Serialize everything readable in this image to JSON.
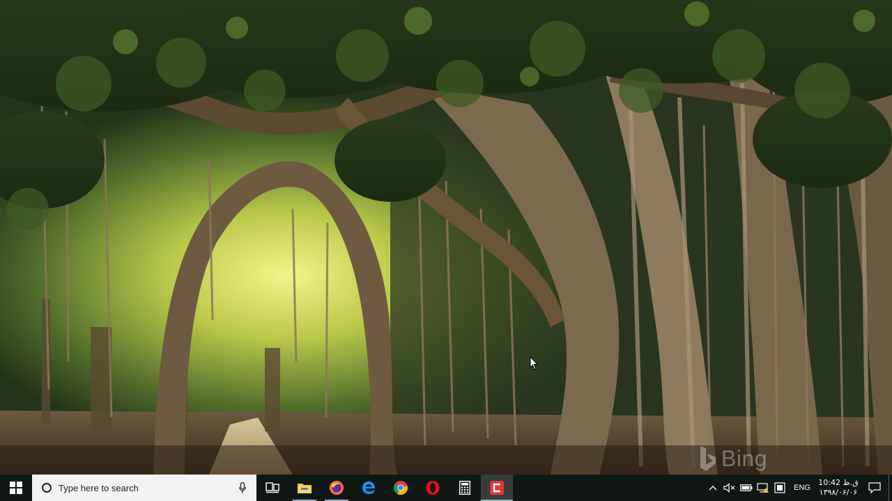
{
  "wallpaper": {
    "name": "banyan-forest",
    "provider": "Bing"
  },
  "watermark": {
    "text": "Bing"
  },
  "taskbar": {
    "search": {
      "placeholder": "Type here to search"
    },
    "pinned": [
      {
        "name": "task-view",
        "icon": "task-view-icon"
      },
      {
        "name": "file-explorer",
        "icon": "folder-icon",
        "color": "#f5c242"
      },
      {
        "name": "firefox",
        "icon": "firefox-icon",
        "color": "#ff7139"
      },
      {
        "name": "edge",
        "icon": "edge-icon",
        "color": "#1e90ff"
      },
      {
        "name": "chrome",
        "icon": "chrome-icon"
      },
      {
        "name": "opera",
        "icon": "opera-icon",
        "color": "#e8101d"
      },
      {
        "name": "calculator",
        "icon": "calculator-icon"
      },
      {
        "name": "camtasia",
        "icon": "camtasia-icon",
        "color": "#e0383b"
      }
    ],
    "tray": {
      "language": "ENG",
      "time": "10:42 ق.ظ",
      "date": "۱۳۹۸/۰۶/۰۶"
    }
  },
  "colors": {
    "taskbar_bg": "#121a16",
    "accent": "#9fb3c8",
    "search_bg": "#f2f2f2"
  }
}
